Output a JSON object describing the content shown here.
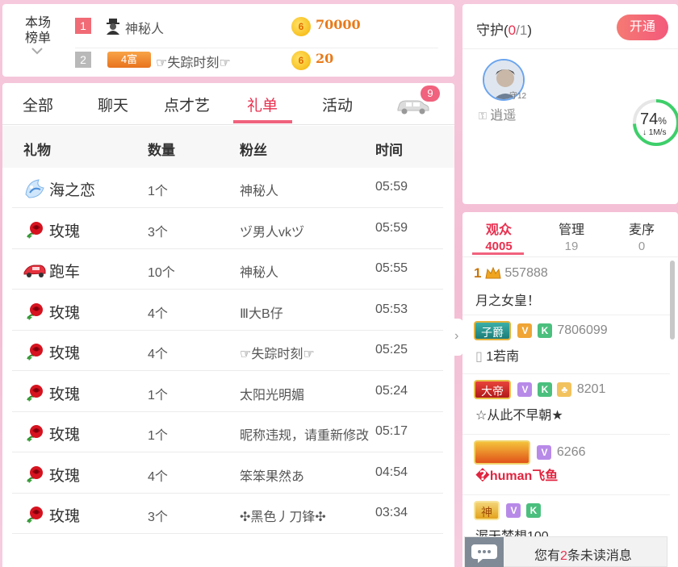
{
  "ranking": {
    "title": "本场榜单",
    "rows": [
      {
        "rank": "1",
        "name": "神秘人",
        "coin_label": "6",
        "amount": "70000"
      },
      {
        "rank": "2",
        "rich_badge": "4富",
        "name": "☞失踪时刻☞",
        "coin_label": "6",
        "amount": "20"
      }
    ]
  },
  "tabs": {
    "items": [
      "全部",
      "聊天",
      "点才艺",
      "礼单",
      "活动"
    ],
    "active": "礼单",
    "car_badge": "9"
  },
  "gift_table": {
    "headers": {
      "gift": "礼物",
      "qty": "数量",
      "fan": "粉丝",
      "time": "时间"
    },
    "rows": [
      {
        "icon": "ocean-love-icon",
        "gift": "海之恋",
        "qty": "1个",
        "fan": "神秘人",
        "time": "05:59"
      },
      {
        "icon": "rose-icon",
        "gift": "玫瑰",
        "qty": "3个",
        "fan": "ヅ男人vkヅ",
        "time": "05:59"
      },
      {
        "icon": "sports-car-icon",
        "gift": "跑车",
        "qty": "10个",
        "fan": "神秘人",
        "time": "05:55"
      },
      {
        "icon": "rose-icon",
        "gift": "玫瑰",
        "qty": "4个",
        "fan": "Ⅲ大B仔",
        "time": "05:53"
      },
      {
        "icon": "rose-icon",
        "gift": "玫瑰",
        "qty": "4个",
        "fan": "☞失踪时刻☞",
        "time": "05:25"
      },
      {
        "icon": "rose-icon",
        "gift": "玫瑰",
        "qty": "1个",
        "fan": "太阳光明媚",
        "time": "05:24"
      },
      {
        "icon": "rose-icon",
        "gift": "玫瑰",
        "qty": "1个",
        "fan": "昵称违规，请重新修改",
        "time": "05:17"
      },
      {
        "icon": "rose-icon",
        "gift": "玫瑰",
        "qty": "4个",
        "fan": "笨笨果然あ",
        "time": "04:54"
      },
      {
        "icon": "rose-icon",
        "gift": "玫瑰",
        "qty": "3个",
        "fan": "✣黑色丿刀锋✣",
        "time": "03:34"
      }
    ]
  },
  "guard": {
    "title": "守护",
    "count": "0",
    "total": "/1",
    "open_button": "开通",
    "guardian_badge": "守12",
    "guardian_name": "逍遥",
    "net_percent": "74",
    "net_percent_unit": "%",
    "net_rate": "↓ 1M/s"
  },
  "audience": {
    "tabs": [
      {
        "label": "观众",
        "count": "4005"
      },
      {
        "label": "管理",
        "count": "19"
      },
      {
        "label": "麦序",
        "count": "0"
      }
    ],
    "items": [
      {
        "rank": "1",
        "id": "557888",
        "nick": "月之女皇！"
      },
      {
        "badge": "子爵",
        "tags": [
          "V",
          "K"
        ],
        "id": "7806099",
        "nick": "1若南"
      },
      {
        "badge": "大帝",
        "tags": [
          "V",
          "K",
          "♣"
        ],
        "id": "8201",
        "nick": "☆从此不早朝★"
      },
      {
        "badge": "",
        "tags": [
          "V"
        ],
        "id": "6266",
        "nick": "�human飞鱼"
      },
      {
        "badge": "神",
        "tags": [
          "V",
          "K"
        ],
        "id": "",
        "nick": "渥天梦想100"
      }
    ]
  },
  "unread": {
    "prefix": "您有",
    "count": "2",
    "suffix": "条未读消息"
  },
  "colors": {
    "accent": "#e8304f",
    "coin": "#e87a1a",
    "background_pink": "#f5c5d9"
  }
}
